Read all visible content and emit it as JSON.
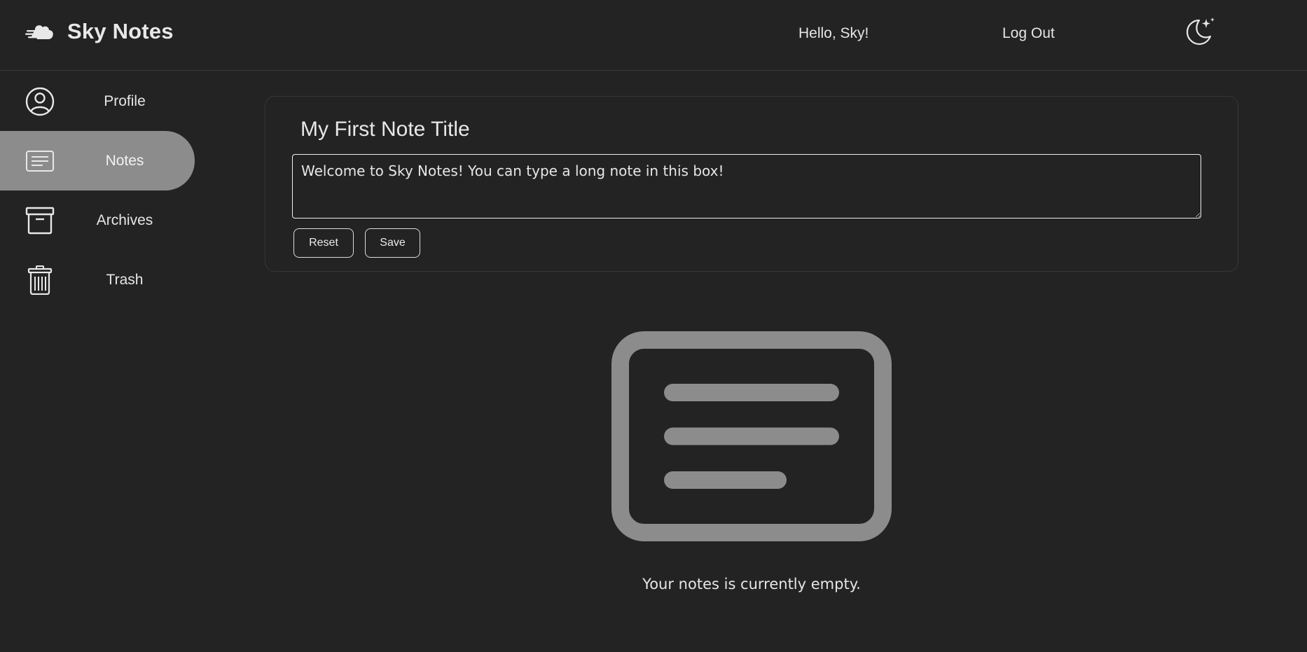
{
  "header": {
    "app_title": "Sky Notes",
    "app_icon": "cloud-icon",
    "greeting": "Hello, Sky!",
    "logout_label": "Log Out",
    "theme_icon": "moon-stars-icon"
  },
  "sidebar": {
    "items": [
      {
        "label": "Profile",
        "icon": "user-circle-icon",
        "active": false
      },
      {
        "label": "Notes",
        "icon": "note-icon",
        "active": true
      },
      {
        "label": "Archives",
        "icon": "archive-box-icon",
        "active": false
      },
      {
        "label": "Trash",
        "icon": "trash-icon",
        "active": false
      }
    ]
  },
  "editor": {
    "title": "My First Note Title",
    "body": "Welcome to Sky Notes! You can type a long note in this box!",
    "reset_label": "Reset",
    "save_label": "Save"
  },
  "empty_state": {
    "icon": "note-icon",
    "message": "Your notes is currently empty."
  },
  "colors": {
    "background": "#232323",
    "active_nav": "#8c8c8c",
    "illustration": "#8c8c8c",
    "text": "#e6e6e6"
  }
}
